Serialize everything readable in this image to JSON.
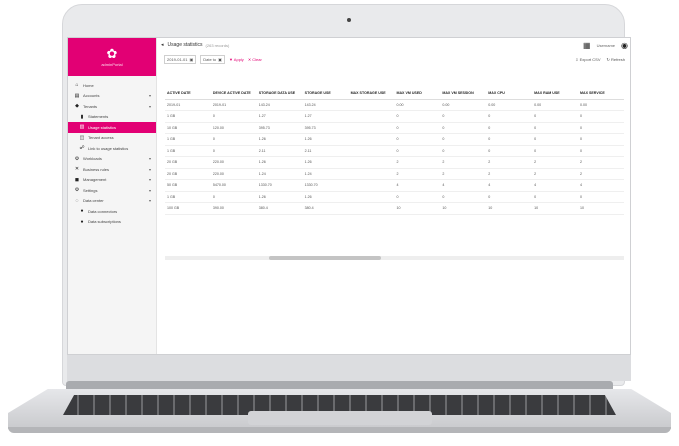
{
  "app": {
    "brand_icon": "gear-icon",
    "brand_name": "adminPortal",
    "accent_color": "#e20074"
  },
  "sidebar": {
    "items": [
      {
        "label": "Home",
        "icon": "home-icon",
        "sub": false,
        "active": false,
        "chevron": false
      },
      {
        "label": "Accounts",
        "icon": "accounts-icon",
        "sub": false,
        "active": false,
        "chevron": true
      },
      {
        "label": "Tenants",
        "icon": "tenants-icon",
        "sub": false,
        "active": false,
        "chevron": true
      },
      {
        "label": "Statements",
        "icon": "document-icon",
        "sub": true,
        "active": false,
        "chevron": false
      },
      {
        "label": "Usage statistics",
        "icon": "chart-icon",
        "sub": true,
        "active": true,
        "chevron": false
      },
      {
        "label": "Tenant access",
        "icon": "key-icon",
        "sub": true,
        "active": false,
        "chevron": false
      },
      {
        "label": "Link to usage statistics",
        "icon": "link-icon",
        "sub": true,
        "active": false,
        "chevron": false
      },
      {
        "label": "Workloads",
        "icon": "workloads-icon",
        "sub": false,
        "active": false,
        "chevron": true
      },
      {
        "label": "Business rules",
        "icon": "rules-icon",
        "sub": false,
        "active": false,
        "chevron": true
      },
      {
        "label": "Management",
        "icon": "management-icon",
        "sub": false,
        "active": false,
        "chevron": true
      },
      {
        "label": "Settings",
        "icon": "settings-icon",
        "sub": false,
        "active": false,
        "chevron": true
      },
      {
        "label": "Data center",
        "icon": "datacenter-icon",
        "sub": false,
        "active": false,
        "chevron": true
      },
      {
        "label": "Data connectors",
        "icon": "connector-icon",
        "sub": true,
        "active": false,
        "chevron": false
      },
      {
        "label": "Data subscriptions",
        "icon": "subscription-icon",
        "sub": true,
        "active": false,
        "chevron": false
      }
    ]
  },
  "header": {
    "title": "Usage statistics",
    "count": "(263 records)",
    "user": "Username"
  },
  "toolbar": {
    "date_from": "2019-01-01",
    "date_to": "Date to",
    "apply": "Apply",
    "clear": "Clear",
    "export": "Export CSV",
    "refresh": "Refresh"
  },
  "table": {
    "columns": [
      "ACTIVE DATE",
      "DEVICE ACTIVE DATE",
      "STORAGE DATA USE",
      "STORAGE USE",
      "MAX STORAGE USE",
      "MAX VM USED",
      "MAX VM SESSION",
      "MAX CPU",
      "MAX RAM USE",
      "MAX SERVICE"
    ],
    "rows": [
      [
        "2019-01",
        "2019-01",
        "143.24",
        "143.24",
        "",
        "0.00",
        "0.00",
        "0.00",
        "0.00",
        "0.00"
      ],
      [
        "1 GB",
        "0",
        "1.27",
        "1.27",
        "",
        "0",
        "0",
        "0",
        "0",
        "0"
      ],
      [
        "10 GB",
        "120.00",
        "395.73",
        "395.73",
        "",
        "0",
        "0",
        "0",
        "0",
        "0"
      ],
      [
        "1 GB",
        "0",
        "1.26",
        "1.26",
        "",
        "0",
        "0",
        "0",
        "0",
        "0"
      ],
      [
        "1 GB",
        "0",
        "2.11",
        "2.11",
        "",
        "0",
        "0",
        "0",
        "0",
        "0"
      ],
      [
        "20 GB",
        "220.00",
        "1.26",
        "1.26",
        "",
        "2",
        "2",
        "2",
        "2",
        "2"
      ],
      [
        "20 GB",
        "220.00",
        "1.24",
        "1.24",
        "",
        "2",
        "2",
        "2",
        "2",
        "2"
      ],
      [
        "50 GB",
        "5470.00",
        "1330.70",
        "1330.70",
        "",
        "4",
        "4",
        "4",
        "4",
        "4"
      ],
      [
        "1 GB",
        "0",
        "1.26",
        "1.26",
        "",
        "0",
        "0",
        "0",
        "0",
        "0"
      ],
      [
        "100 GB",
        "390.00",
        "380.4",
        "380.4",
        "",
        "10",
        "10",
        "10",
        "10",
        "10"
      ]
    ]
  }
}
